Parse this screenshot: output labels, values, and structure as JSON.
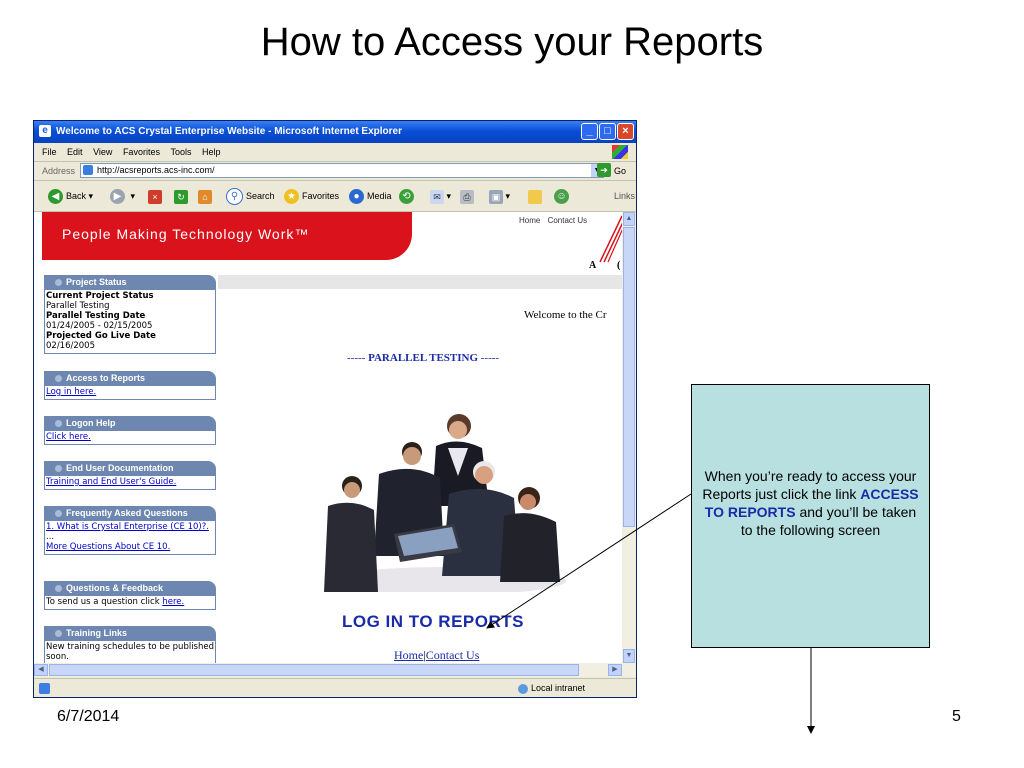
{
  "slide": {
    "title": "How to Access your Reports",
    "date": "6/7/2014",
    "page_number": "5"
  },
  "window": {
    "title": "Welcome to ACS Crystal Enterprise Website - Microsoft Internet Explorer",
    "menu": [
      "File",
      "Edit",
      "View",
      "Favorites",
      "Tools",
      "Help"
    ],
    "address_label": "Address",
    "address_url": "http://acsreports.acs-inc.com/",
    "go_label": "Go",
    "toolbar": {
      "back": "Back",
      "search": "Search",
      "favorites": "Favorites",
      "media": "Media",
      "links": "Links"
    },
    "status_zone": "Local intranet"
  },
  "page": {
    "banner_text": "People Making Technology Work™",
    "top_links": [
      "Home",
      "Contact Us"
    ],
    "logo_letters": [
      "A",
      "("
    ],
    "welcome_text": "Welcome to the Cr",
    "parallel_text": {
      "left": "----- ",
      "main": "PARALLEL TESTING",
      "right": " -----"
    },
    "login_link": "LOG IN TO REPORTS",
    "bottom_links": [
      "Home",
      "Contact Us"
    ],
    "bottom_sep": "|",
    "panels": {
      "project_status": {
        "title": "Project Status",
        "current_label": "Current Project Status",
        "current_value": "Parallel Testing",
        "testing_label": "Parallel Testing Date",
        "testing_value": "01/24/2005 - 02/15/2005",
        "golive_label": "Projected Go Live Date",
        "golive_value": "02/16/2005"
      },
      "access_reports": {
        "title": "Access to Reports",
        "link": "Log in here."
      },
      "logon_help": {
        "title": "Logon Help",
        "link": "Click here."
      },
      "end_user_docs": {
        "title": "End User Documentation",
        "link": "Training and End User's Guide."
      },
      "faq": {
        "title": "Frequently Asked Questions",
        "link1": "1. What is Crystal Enterprise (CE 10)?.",
        "ellipsis": "...",
        "link2": "More Questions About CE 10."
      },
      "feedback": {
        "title": "Questions & Feedback",
        "text": "To send us a question click ",
        "link": "here."
      },
      "training": {
        "title": "Training Links",
        "text": "New training schedules to be published soon."
      }
    }
  },
  "callout": {
    "text_before": "When you’re ready to access your Reports just click the link ",
    "highlight": "ACCESS TO REPORTS",
    "text_after": " and you’ll be taken to the following screen",
    "background": "#b8e0e0"
  },
  "colors": {
    "banner_red": "#d9121b",
    "panel_header": "#6e87b0",
    "link_blue": "#1a2ba8"
  }
}
